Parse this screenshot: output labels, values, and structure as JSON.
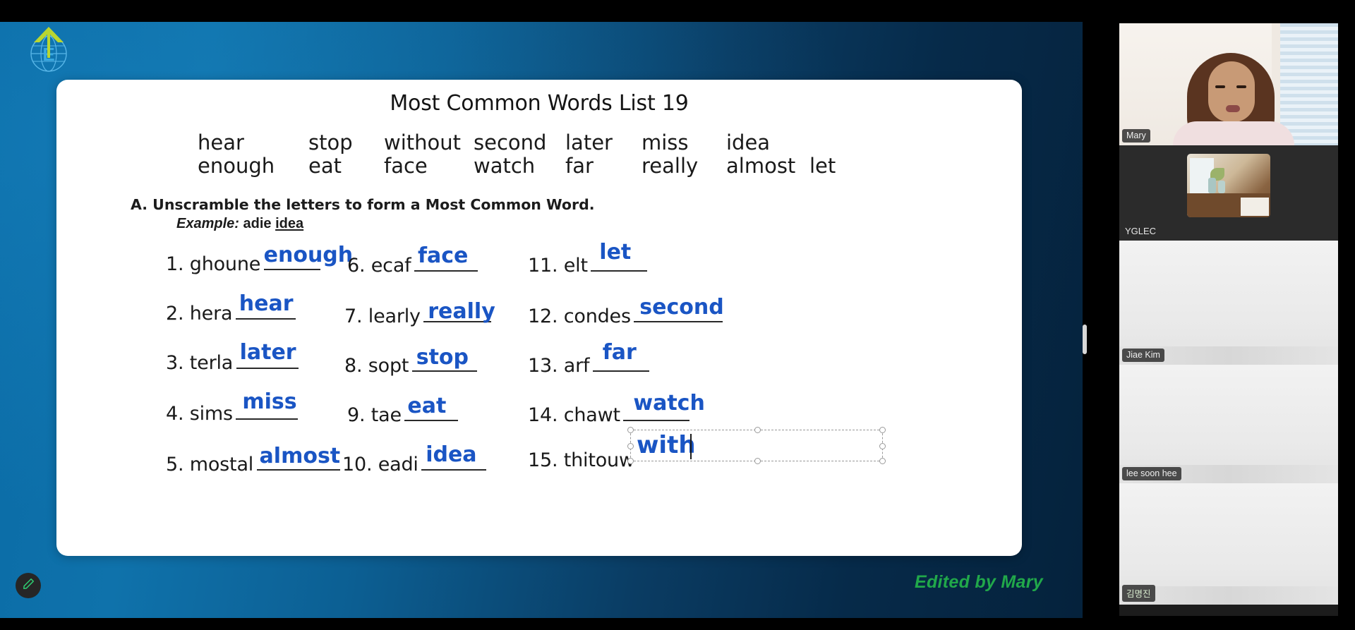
{
  "app": {
    "type": "video-conference-screen-share",
    "accent_green": "#4ae08a",
    "answer_color": "#1a55c4",
    "slide_bg_blue": "#0a5e92"
  },
  "slide": {
    "title": "Most Common Words List 19",
    "word_bank": {
      "row1": [
        "hear",
        "stop",
        "without",
        "second",
        "later",
        "miss",
        "idea"
      ],
      "row2": [
        "enough",
        "eat",
        "face",
        "watch",
        "far",
        "really",
        "almost",
        "let"
      ]
    },
    "instruction": "A. Unscramble the letters to form a Most Common Word.",
    "example_label": "Example:",
    "example_scramble": "adie",
    "example_answer": "idea",
    "questions": [
      {
        "num": "1.",
        "scramble": "ghoune",
        "answer": "enough"
      },
      {
        "num": "2.",
        "scramble": "hera",
        "answer": "hear"
      },
      {
        "num": "3.",
        "scramble": "terla",
        "answer": "later"
      },
      {
        "num": "4.",
        "scramble": "sims",
        "answer": "miss"
      },
      {
        "num": "5.",
        "scramble": "mostal",
        "answer": "almost"
      },
      {
        "num": "6.",
        "scramble": "ecaf",
        "answer": "face"
      },
      {
        "num": "7.",
        "scramble": "learly",
        "answer": "really"
      },
      {
        "num": "8.",
        "scramble": "sopt",
        "answer": "stop"
      },
      {
        "num": "9.",
        "scramble": "tae",
        "answer": "eat"
      },
      {
        "num": "10.",
        "scramble": "eadi",
        "answer": "idea"
      },
      {
        "num": "11.",
        "scramble": "elt",
        "answer": "let"
      },
      {
        "num": "12.",
        "scramble": "condes",
        "answer": "second"
      },
      {
        "num": "13.",
        "scramble": "arf",
        "answer": "far"
      },
      {
        "num": "14.",
        "scramble": "chawt",
        "answer": "watch"
      },
      {
        "num": "15.",
        "scramble": "thitouw",
        "answer": ""
      }
    ],
    "footer_credit": "Edited by Mary"
  },
  "text_box": {
    "value": "with",
    "state": "selected-editing"
  },
  "toolbar": {
    "annotate_icon": "pencil-icon"
  },
  "participants": [
    {
      "name": "Mary",
      "active_speaker": true,
      "video": true
    },
    {
      "name": "YGLEC",
      "active_speaker": false,
      "video": true
    },
    {
      "name": "Jiae Kim",
      "active_speaker": false,
      "video": true
    },
    {
      "name": "lee soon hee",
      "active_speaker": false,
      "video": true
    },
    {
      "name": "김명진",
      "active_speaker": false,
      "video": true
    }
  ]
}
